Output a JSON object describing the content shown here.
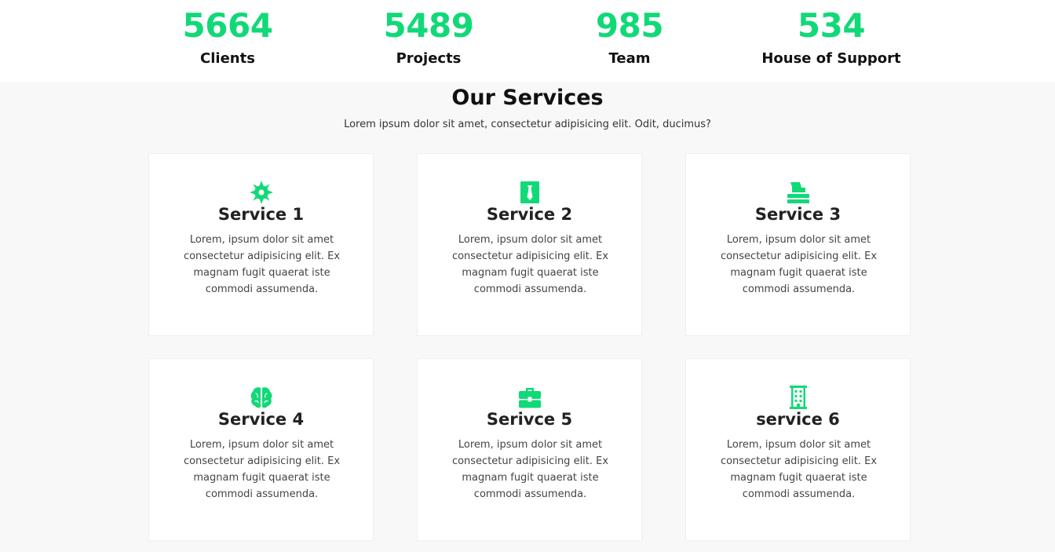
{
  "colors": {
    "accent": "#11d977",
    "page_bg": "#f8f8f8",
    "card_bg": "#ffffff"
  },
  "stats": [
    {
      "number": "5664",
      "label": "Clients"
    },
    {
      "number": "5489",
      "label": "Projects"
    },
    {
      "number": "985",
      "label": "Team"
    },
    {
      "number": "534",
      "label": "House of Support"
    }
  ],
  "services": {
    "title": "Our Services",
    "subtitle": "Lorem ipsum dolor sit amet, consectetur adipisicing elit. Odit, ducimus?",
    "cards": [
      {
        "icon": "badge-icon",
        "title": "Service 1",
        "text": "Lorem, ipsum dolor sit amet consectetur adipisicing elit. Ex magnam fugit quaerat iste commodi assumenda."
      },
      {
        "icon": "necktie-icon",
        "title": "Service 2",
        "text": "Lorem, ipsum dolor sit amet consectetur adipisicing elit. Ex magnam fugit quaerat iste commodi assumenda."
      },
      {
        "icon": "inbox-icon",
        "title": "Service 3",
        "text": "Lorem, ipsum dolor sit amet consectetur adipisicing elit. Ex magnam fugit quaerat iste commodi assumenda."
      },
      {
        "icon": "brain-icon",
        "title": "Service 4",
        "text": "Lorem, ipsum dolor sit amet consectetur adipisicing elit. Ex magnam fugit quaerat iste commodi assumenda."
      },
      {
        "icon": "briefcase-icon",
        "title": "Serivce 5",
        "text": "Lorem, ipsum dolor sit amet consectetur adipisicing elit. Ex magnam fugit quaerat iste commodi assumenda."
      },
      {
        "icon": "building-icon",
        "title": "service 6",
        "text": "Lorem, ipsum dolor sit amet consectetur adipisicing elit. Ex magnam fugit quaerat iste commodi assumenda."
      }
    ]
  }
}
